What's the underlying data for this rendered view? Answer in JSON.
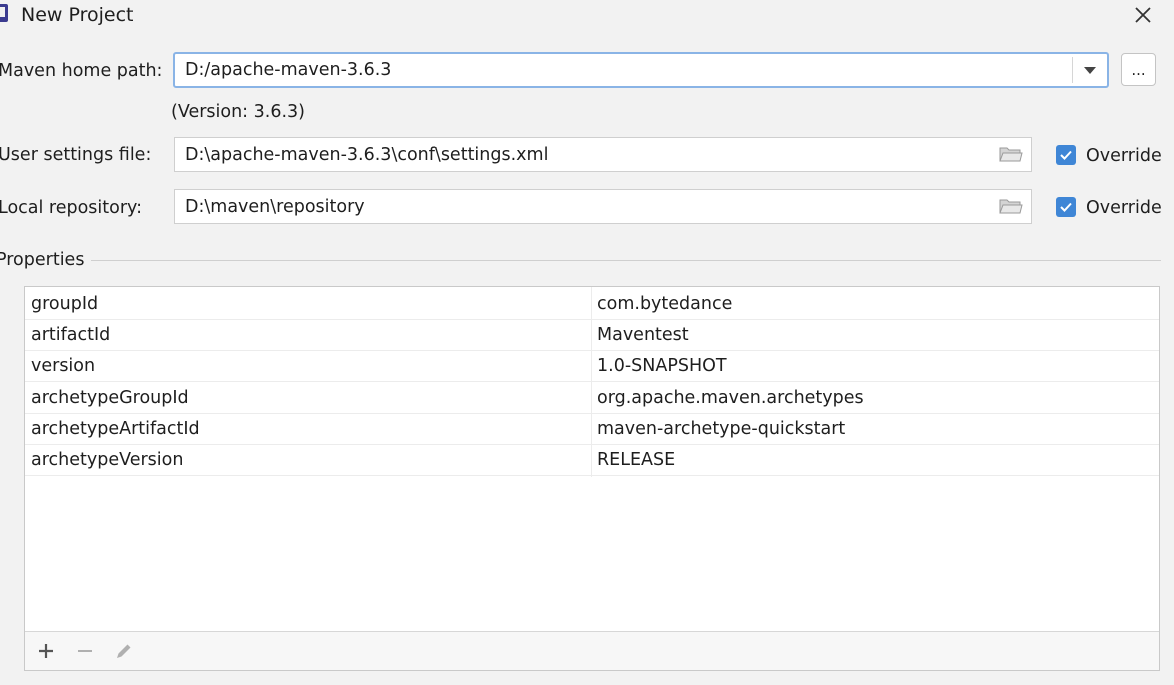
{
  "dialog": {
    "title": "New Project"
  },
  "maven": {
    "home_label": "Maven home path:",
    "home_value": "D:/apache-maven-3.6.3",
    "version_text": "(Version: 3.6.3)",
    "browse_label": "...",
    "user_settings_label": "User settings file:",
    "user_settings_value": "D:\\apache-maven-3.6.3\\conf\\settings.xml",
    "local_repo_label": "Local repository:",
    "local_repo_value": "D:\\maven\\repository",
    "override_label": "Override",
    "user_settings_override": true,
    "local_repo_override": true
  },
  "properties": {
    "section_label": "Properties",
    "rows": [
      {
        "key": "groupId",
        "value": "com.bytedance"
      },
      {
        "key": "artifactId",
        "value": "Maventest"
      },
      {
        "key": "version",
        "value": "1.0-SNAPSHOT"
      },
      {
        "key": "archetypeGroupId",
        "value": "org.apache.maven.archetypes"
      },
      {
        "key": "archetypeArtifactId",
        "value": "maven-archetype-quickstart"
      },
      {
        "key": "archetypeVersion",
        "value": "RELEASE"
      }
    ]
  },
  "colors": {
    "accent": "#3f86d6",
    "focus_border": "#8ab4e6"
  },
  "icons": [
    "close-icon",
    "dropdown-arrow-icon",
    "folder-icon",
    "checkmark-icon",
    "plus-icon",
    "minus-icon",
    "edit-icon"
  ]
}
